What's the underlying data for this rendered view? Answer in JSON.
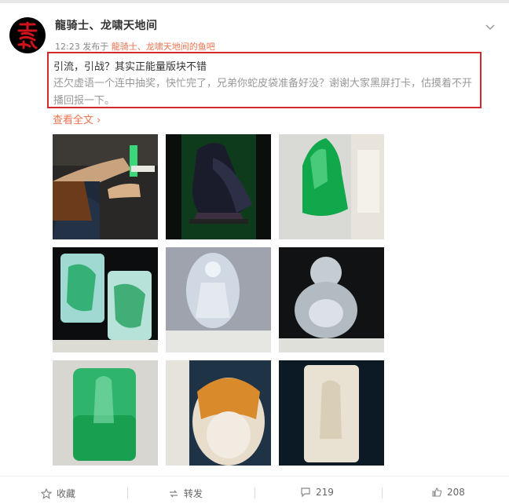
{
  "post": {
    "author": "龍骑士、龙啸天地间",
    "time": "12:23",
    "from_prefix": "发布于",
    "source": "龍骑士、龙啸天地间的鱼吧",
    "line1": "引流，引战？其实正能量版块不错",
    "line2": "还欠虚语一个连中抽奖，快忙完了，兄弟你蛇皮袋准备好没？谢谢大家黑屏打卡，估摸着不开播回报一下。",
    "more": "查看全文",
    "more_arrow": "›"
  },
  "images": [
    {
      "name": "photo-hand-jade"
    },
    {
      "name": "photo-eagle-carving"
    },
    {
      "name": "photo-green-jade-block"
    },
    {
      "name": "photo-two-jade-pendants"
    },
    {
      "name": "photo-guanyin-pendant"
    },
    {
      "name": "photo-buddha-carving"
    },
    {
      "name": "photo-green-guanyin"
    },
    {
      "name": "photo-amber-pendant"
    },
    {
      "name": "photo-white-jade-plaque"
    }
  ],
  "actions": {
    "collect": "收藏",
    "repost": "转发",
    "comments": "219",
    "likes": "208"
  },
  "colors": {
    "accent": "#eb7350",
    "highlight_border": "#d3282c"
  },
  "icons": [
    "chevron-down-icon",
    "star-icon",
    "repost-icon",
    "comment-icon",
    "like-icon"
  ]
}
